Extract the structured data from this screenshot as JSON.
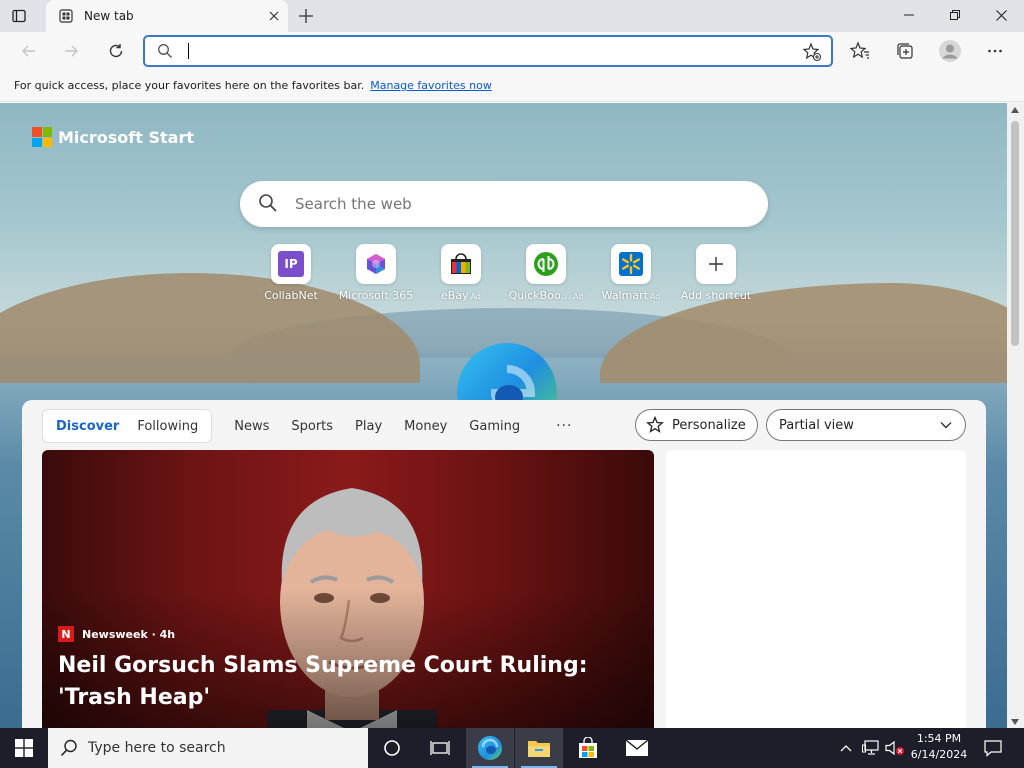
{
  "browser": {
    "tab": {
      "title": "New tab"
    },
    "address_bar": {
      "value": "",
      "placeholder": ""
    },
    "favorites_bar": {
      "message": "For quick access, place your favorites here on the favorites bar.",
      "link": "Manage favorites now"
    }
  },
  "page": {
    "brand": "Microsoft Start",
    "search": {
      "placeholder": "Search the web"
    },
    "shortcuts": [
      {
        "label": "CollabNet",
        "ad": "",
        "icon": "collabnet-icon"
      },
      {
        "label": "Microsoft 365",
        "ad": "",
        "icon": "microsoft-365-icon"
      },
      {
        "label": "eBay",
        "ad": "Ad",
        "icon": "ebay-icon"
      },
      {
        "label": "QuickBoo...",
        "ad": "Ad",
        "icon": "quickbooks-icon"
      },
      {
        "label": "Walmart",
        "ad": "Ad",
        "icon": "walmart-icon"
      },
      {
        "label": "Add shortcut",
        "ad": "",
        "icon": "plus-icon"
      }
    ],
    "collabnet_text": "IP",
    "feed": {
      "tabs": [
        "Discover",
        "Following"
      ],
      "active_tab": "Discover",
      "categories": [
        "News",
        "Sports",
        "Play",
        "Money",
        "Gaming"
      ],
      "more": "···",
      "personalize": "Personalize",
      "view": "Partial view",
      "hero": {
        "source_logo": "N",
        "source": "Newsweek · 4h",
        "headline": "Neil Gorsuch Slams Supreme Court Ruling: 'Trash Heap'"
      }
    }
  },
  "taskbar": {
    "search_placeholder": "Type here to search",
    "time": "1:54 PM",
    "date": "6/14/2024"
  },
  "colors": {
    "accent": "#3c78c8",
    "link": "#0a5ad0",
    "feed_active": "#1a66c8",
    "newsweek_red": "#d81c1c",
    "taskbar": "#1c1f2a"
  }
}
